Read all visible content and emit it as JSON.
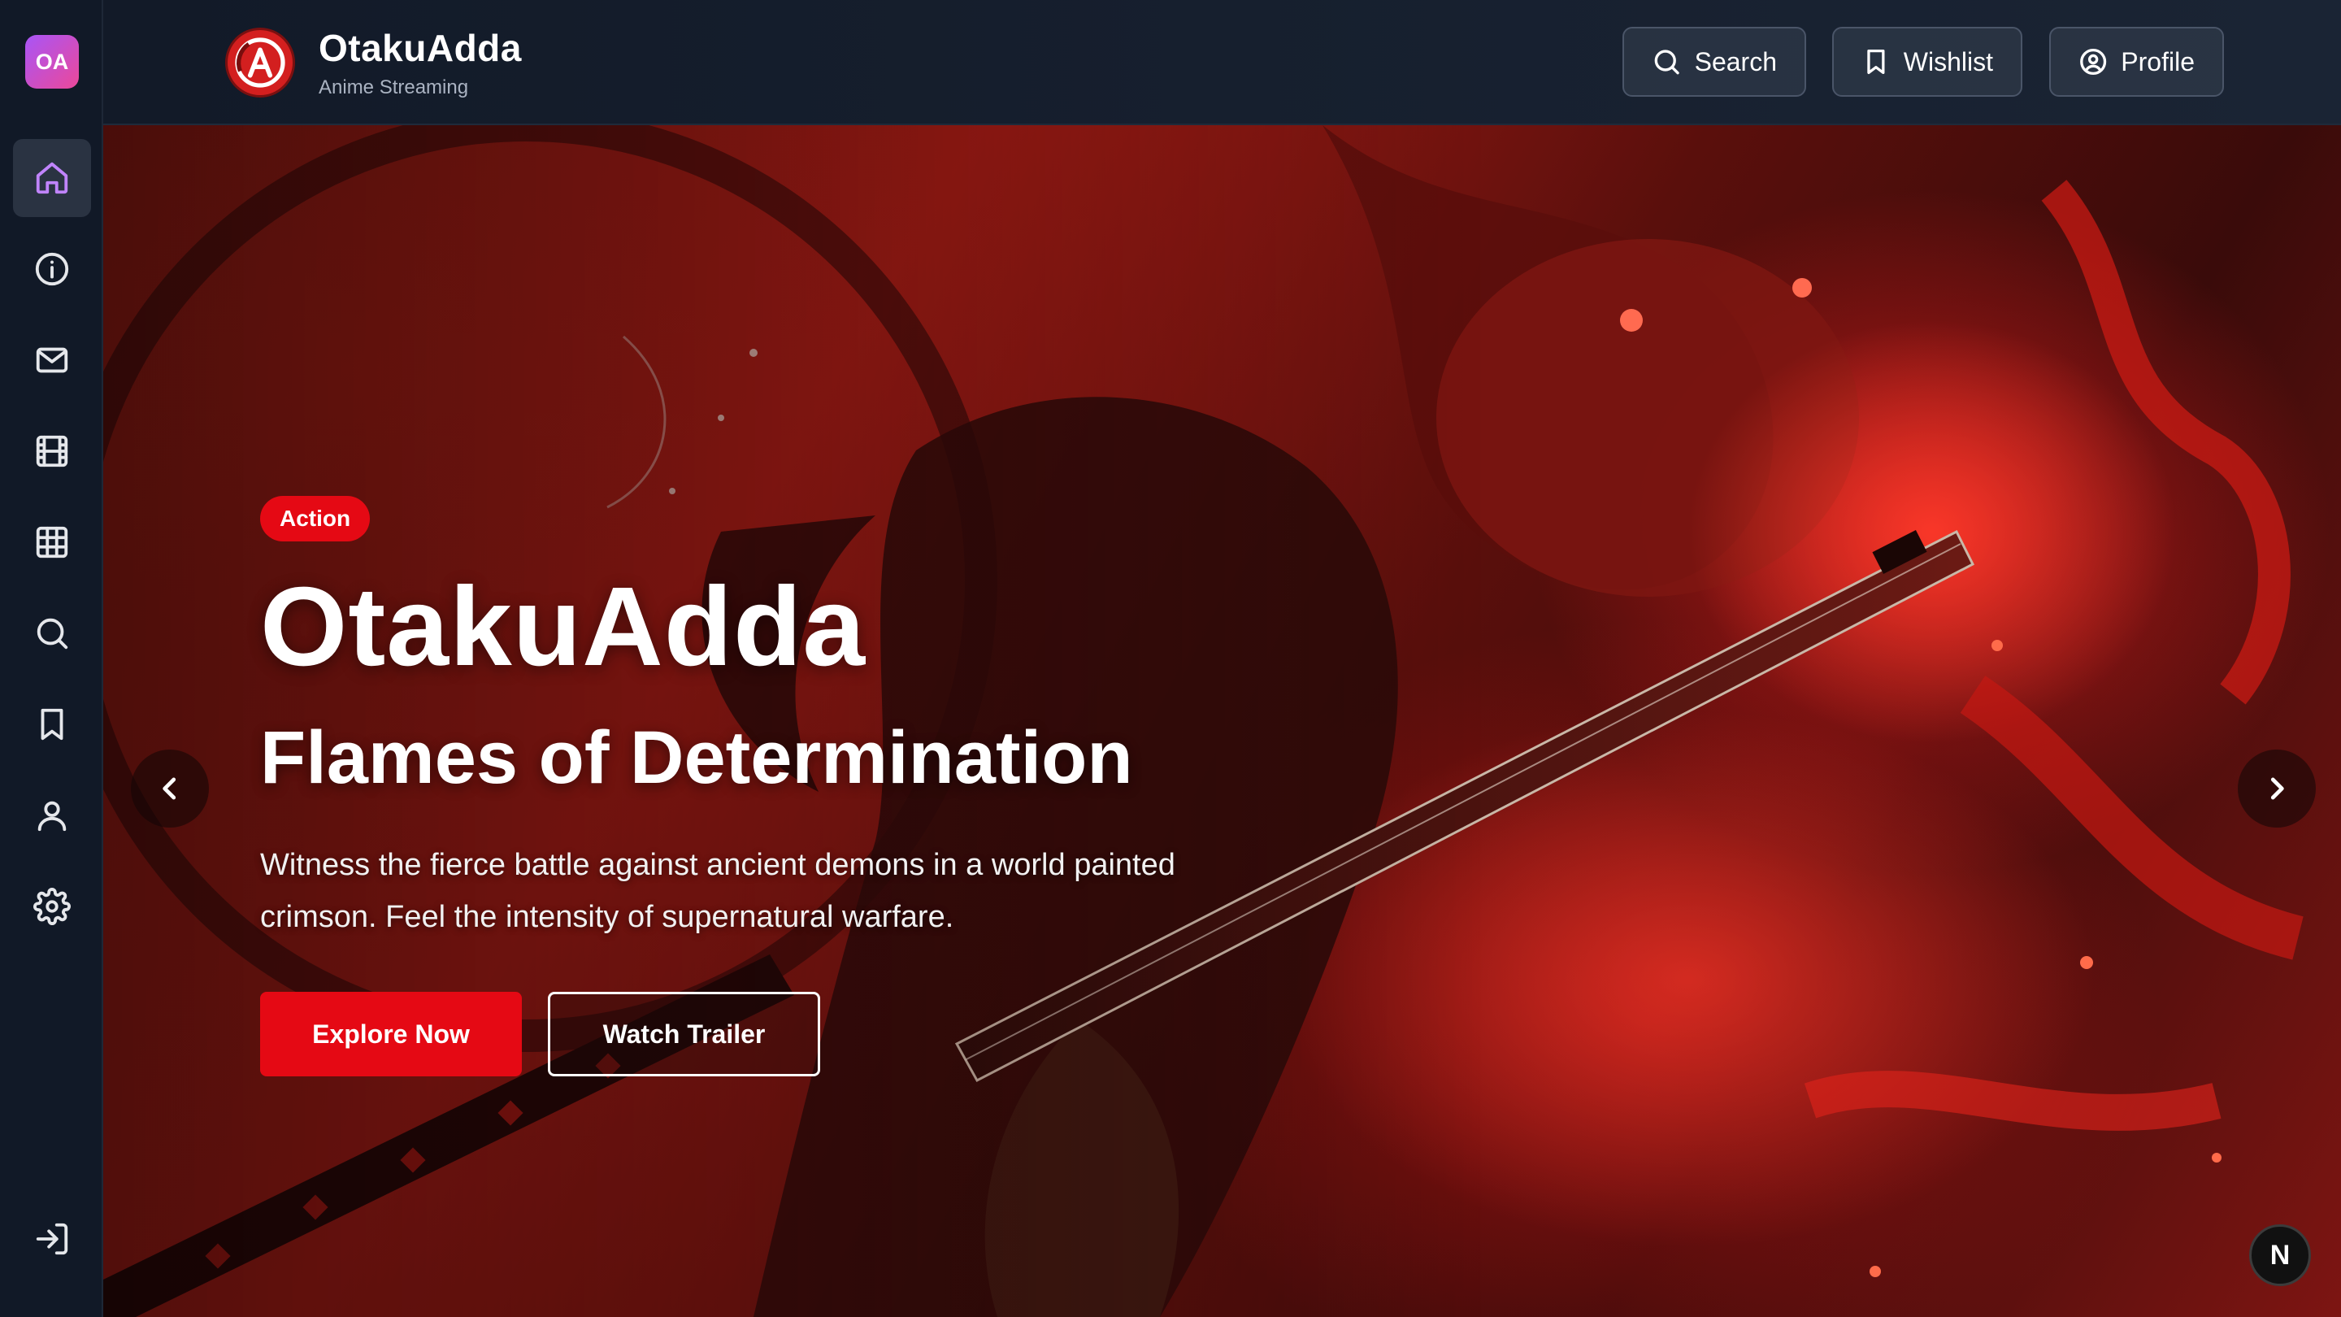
{
  "sidebar": {
    "logo_text": "OA",
    "items": [
      {
        "name": "home",
        "icon": "home-icon",
        "active": true
      },
      {
        "name": "about",
        "icon": "info-icon"
      },
      {
        "name": "contact",
        "icon": "mail-icon"
      },
      {
        "name": "movies",
        "icon": "film-icon"
      },
      {
        "name": "categories",
        "icon": "grid-icon"
      },
      {
        "name": "search",
        "icon": "search-icon"
      },
      {
        "name": "wishlist",
        "icon": "bookmark-icon"
      },
      {
        "name": "profile",
        "icon": "user-icon"
      },
      {
        "name": "settings",
        "icon": "gear-icon"
      },
      {
        "name": "login",
        "icon": "login-icon"
      }
    ]
  },
  "header": {
    "brand_name": "OtakuAdda",
    "brand_sub": "Anime Streaming",
    "search_label": "Search",
    "wishlist_label": "Wishlist",
    "profile_label": "Profile"
  },
  "hero": {
    "genre": "Action",
    "title": "OtakuAdda",
    "subtitle": "Flames of Determination",
    "description": "Witness the fierce battle against ancient demons in a world painted crimson. Feel the intensity of supernatural warfare.",
    "primary_button": "Explore Now",
    "secondary_button": "Watch Trailer"
  },
  "corner_badge": "N",
  "colors": {
    "accent_red": "#e50914",
    "active_icon": "#c084fc",
    "logo_gradient_start": "#a855f7",
    "logo_gradient_end": "#ec4899"
  }
}
